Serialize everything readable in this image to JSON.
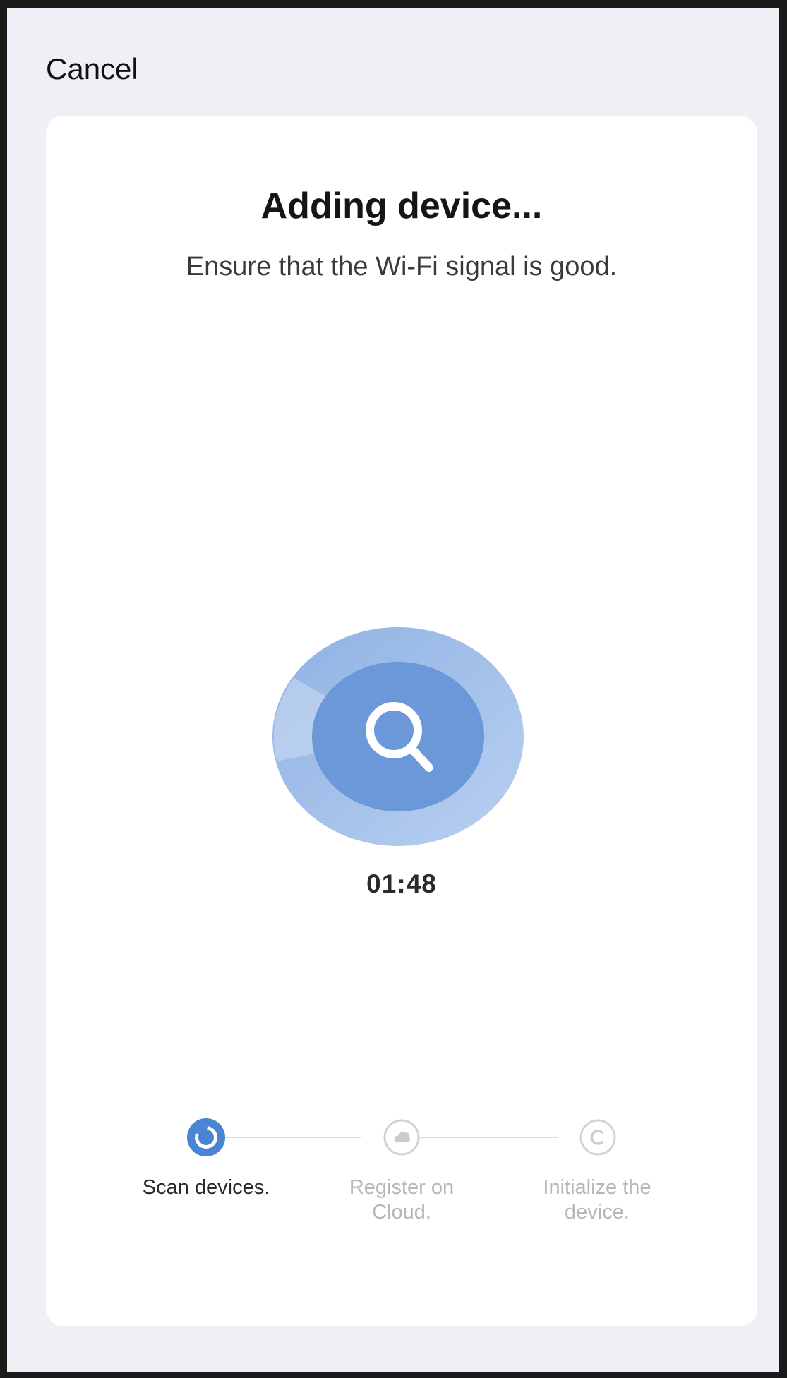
{
  "header": {
    "cancel_label": "Cancel"
  },
  "main": {
    "title": "Adding device...",
    "subtitle": "Ensure that the Wi-Fi signal is good.",
    "timer": "01:48"
  },
  "steps": [
    {
      "label": "Scan devices.",
      "state": "active",
      "icon": "scan-progress-icon"
    },
    {
      "label": "Register on Cloud.",
      "state": "pending",
      "icon": "cloud-icon"
    },
    {
      "label": "Initialize the device.",
      "state": "pending",
      "icon": "device-init-icon"
    }
  ],
  "colors": {
    "accent": "#4a84d4",
    "radar_outer": "#a8c4ea",
    "radar_inner": "#6a98d8",
    "inactive": "#d0d3d9"
  }
}
